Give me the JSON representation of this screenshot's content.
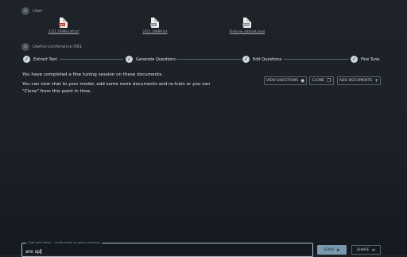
{
  "user_block": {
    "avatar_initials": "U",
    "label": "User",
    "files": [
      {
        "name": "2311.16989.pdf.txt",
        "type": "PDF",
        "icon": "pdf-file-icon",
        "color": "#c0392b"
      },
      {
        "name": "2311.16989.txt",
        "type": "TXT",
        "icon": "txt-file-icon",
        "color": "#7f8c8d"
      },
      {
        "name": "finetune_dataset.jsonl",
        "type": "JSON",
        "icon": "json-file-icon",
        "color": "#7f8c8d"
      }
    ]
  },
  "assistant_block": {
    "avatar_initials": "U",
    "label": "Useful-conference-561",
    "steps": [
      "Extract Text",
      "Generate Questions",
      "Edit Questions",
      "Fine Tune"
    ],
    "message_line1": "You have completed a fine tuning session on these documents.",
    "message_line2": "You can now chat to your model, add some more documents and re-train or you can",
    "message_line3": "\"Clone\" from this point in time.",
    "buttons": {
      "view_questions": "VIEW QUESTIONS",
      "clone": "CLONE",
      "add_documents": "ADD DOCUMENTS"
    }
  },
  "chat": {
    "legend": "Chat with Helix... (shift+enter to add a newline)",
    "value": "are sp"
  },
  "actions": {
    "send": "SEND",
    "share": "SHARE"
  },
  "colors": {
    "background": "#1c2127",
    "accent": "#7a99ae",
    "step_done": "#cfd6dc"
  }
}
